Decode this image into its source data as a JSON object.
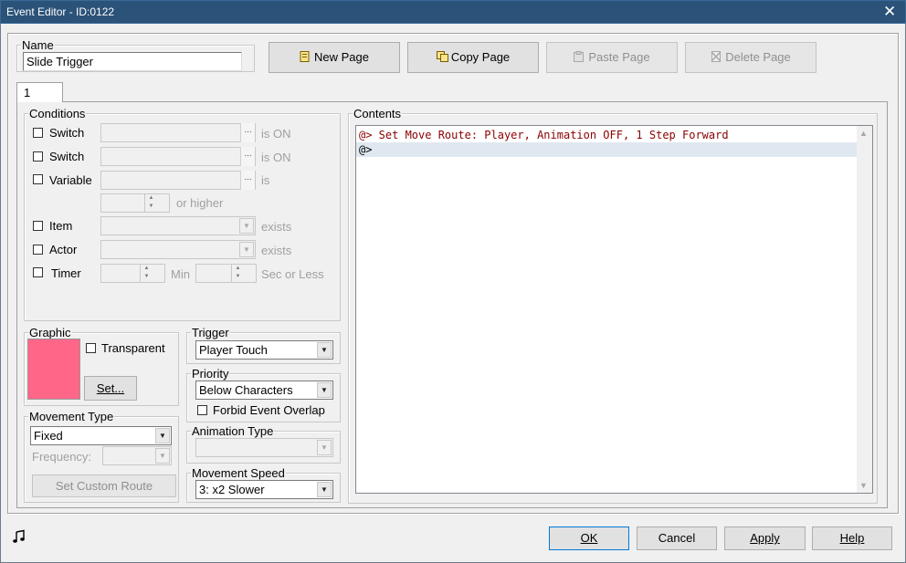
{
  "window": {
    "title": "Event Editor - ID:0122",
    "close_icon": "close-icon"
  },
  "name_group": {
    "label": "Name",
    "value": "Slide Trigger"
  },
  "page_buttons": {
    "new_page": "New Page",
    "copy_page": "Copy Page",
    "paste_page": "Paste Page",
    "delete_page": "Delete Page"
  },
  "tabs": [
    {
      "label": "1"
    }
  ],
  "conditions": {
    "label": "Conditions",
    "switch1": {
      "label": "Switch",
      "suffix": "is ON"
    },
    "switch2": {
      "label": "Switch",
      "suffix": "is ON"
    },
    "variable": {
      "label": "Variable",
      "suffix": "is",
      "compare": "or higher"
    },
    "item": {
      "label": "Item",
      "suffix": "exists"
    },
    "actor": {
      "label": "Actor",
      "suffix": "exists"
    },
    "timer": {
      "label": "Timer",
      "min_label": "Min",
      "sec_label": "Sec or Less"
    },
    "browse_glyph": "..."
  },
  "graphic": {
    "label": "Graphic",
    "transparent_label": "Transparent",
    "set_button": "Set...",
    "swatch_color": "#ff6688"
  },
  "trigger": {
    "label": "Trigger",
    "selected": "Player Touch"
  },
  "priority": {
    "label": "Priority",
    "selected": "Below Characters",
    "forbid_overlap": "Forbid Event Overlap"
  },
  "movement_type": {
    "label": "Movement Type",
    "selected": "Fixed",
    "frequency_label": "Frequency:",
    "custom_route_button": "Set Custom Route"
  },
  "animation_type": {
    "label": "Animation Type",
    "selected": ""
  },
  "movement_speed": {
    "label": "Movement Speed",
    "selected": "3: x2 Slower"
  },
  "contents": {
    "label": "Contents",
    "lines": [
      {
        "text": "@> Set Move Route: Player, Animation OFF, 1 Step Forward",
        "color": "#8b0000"
      },
      {
        "text": "@>",
        "color": "#000000"
      }
    ],
    "selected_color": "#dfe8f0"
  },
  "footer": {
    "music_icon": "music-note-icon",
    "ok": "OK",
    "cancel": "Cancel",
    "apply": "Apply",
    "help": "Help"
  }
}
